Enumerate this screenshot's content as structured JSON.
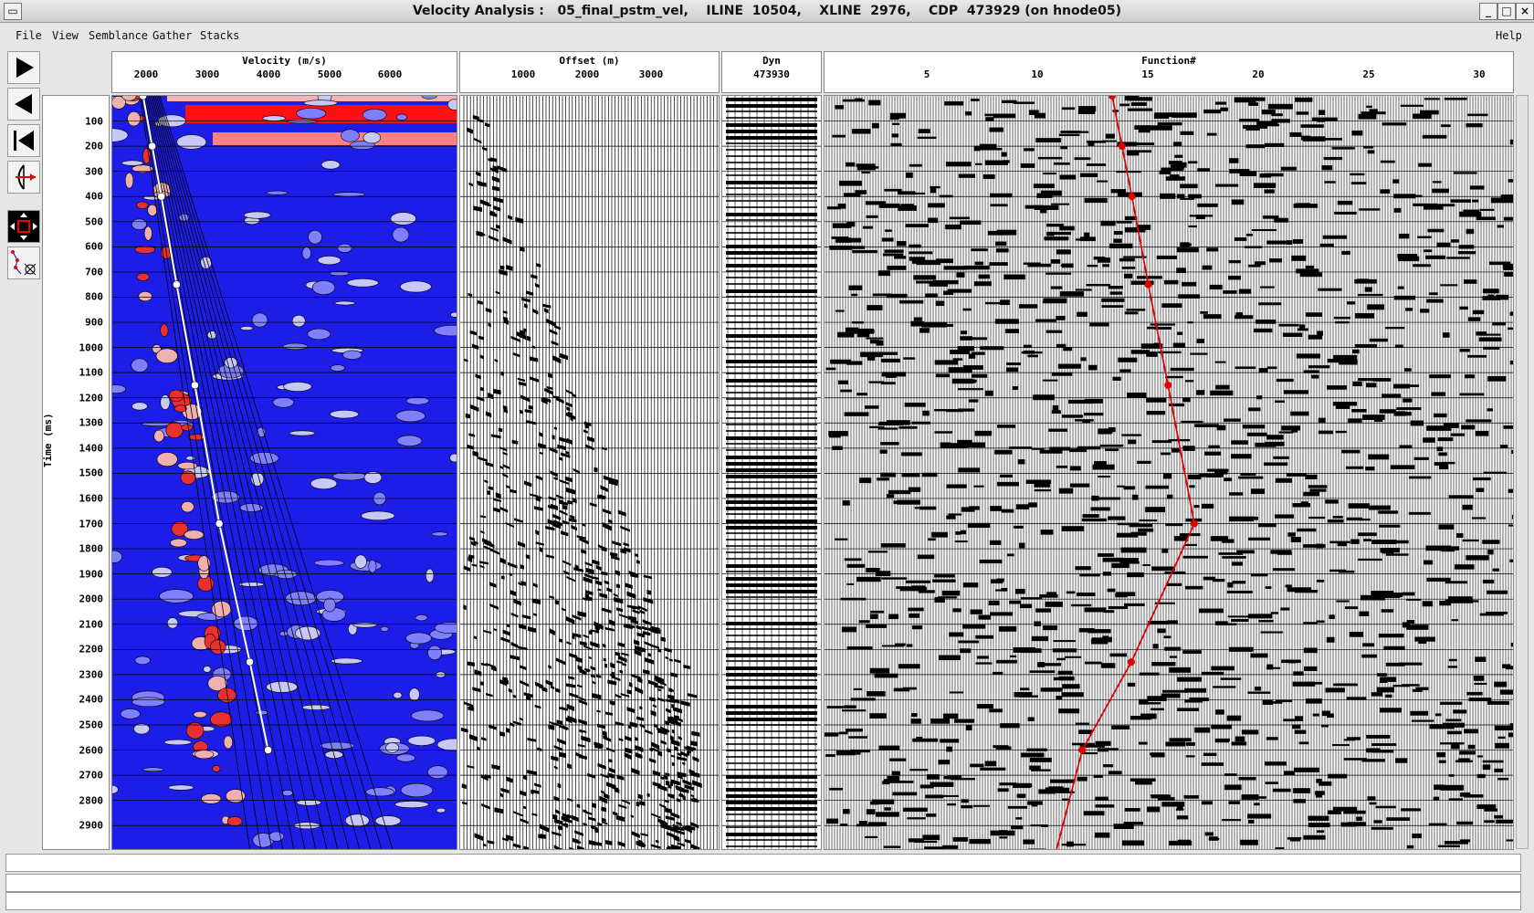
{
  "window": {
    "title": "Velocity Analysis :   05_final_pstm_vel,    ILINE  10504,    XLINE  2976,    CDP  473929 (on hnode05)"
  },
  "menu": {
    "file": "File",
    "view": "View",
    "semblance": "Semblance",
    "gather": "Gather",
    "stacks": "Stacks",
    "help": "Help"
  },
  "panels": {
    "semblance": {
      "title": "Velocity (m/s)",
      "ticks": [
        "2000",
        "3000",
        "4000",
        "5000",
        "6000"
      ]
    },
    "gather": {
      "title": "Offset (m)",
      "ticks": [
        "1000",
        "2000",
        "3000"
      ]
    },
    "dyn": {
      "title": "Dyn",
      "cdp": "473930"
    },
    "function": {
      "title": "Function#",
      "ticks": [
        "5",
        "10",
        "15",
        "20",
        "25",
        "30"
      ]
    }
  },
  "time_axis": {
    "label": "Time (ms)",
    "ticks": [
      "100",
      "200",
      "300",
      "400",
      "500",
      "600",
      "700",
      "800",
      "900",
      "1000",
      "1100",
      "1200",
      "1300",
      "1400",
      "1500",
      "1600",
      "1700",
      "1800",
      "1900",
      "2000",
      "2100",
      "2200",
      "2300",
      "2400",
      "2500",
      "2600",
      "2700",
      "2800",
      "2900"
    ]
  },
  "picks": [
    {
      "time": 0,
      "velocity": 1950
    },
    {
      "time": 200,
      "velocity": 2100
    },
    {
      "time": 400,
      "velocity": 2250
    },
    {
      "time": 750,
      "velocity": 2500
    },
    {
      "time": 1150,
      "velocity": 2800
    },
    {
      "time": 1700,
      "velocity": 3200
    },
    {
      "time": 2250,
      "velocity": 3700
    },
    {
      "time": 2600,
      "velocity": 4000
    }
  ],
  "colors": {
    "semblance_bg": "#1d1de8",
    "semblance_hot": "#ff0000",
    "pick_white": "#ffffff",
    "function_pick": "#e00000"
  }
}
